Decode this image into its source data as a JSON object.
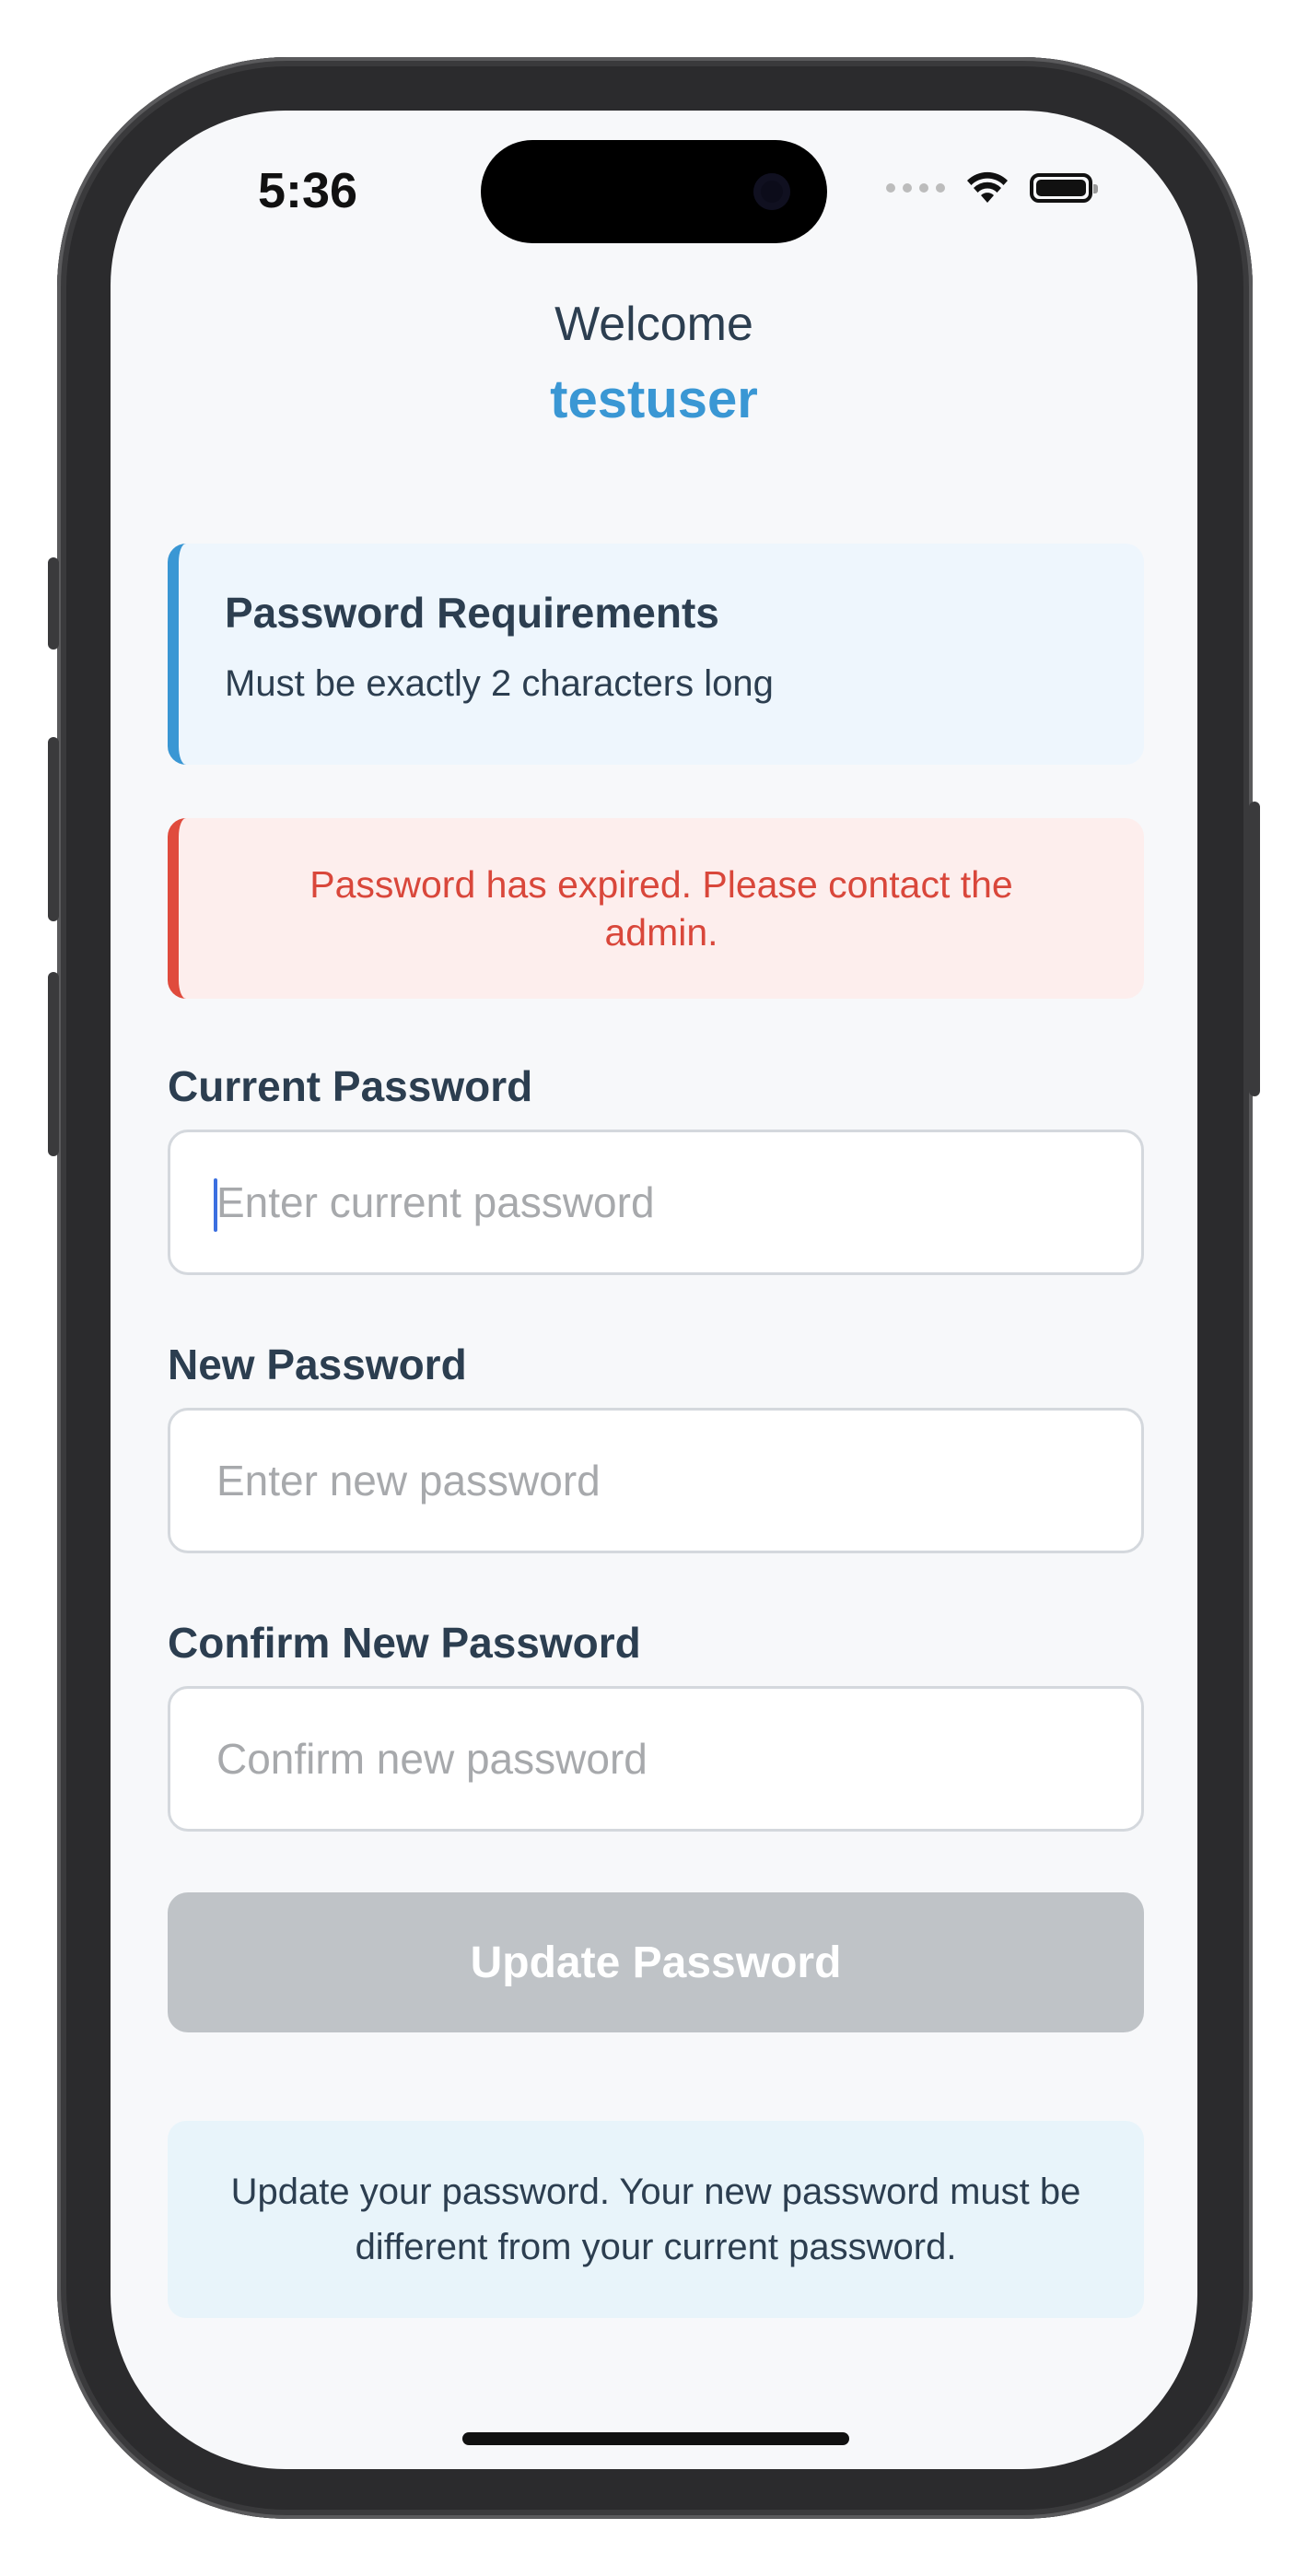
{
  "status_bar": {
    "time": "5:36"
  },
  "header": {
    "welcome_label": "Welcome",
    "username": "testuser"
  },
  "requirements": {
    "title": "Password Requirements",
    "text": "Must be exactly 2 characters long"
  },
  "error": {
    "message": "Password has expired. Please contact the admin."
  },
  "form": {
    "current": {
      "label": "Current Password",
      "placeholder": "Enter current password",
      "value": ""
    },
    "new": {
      "label": "New Password",
      "placeholder": "Enter new password",
      "value": ""
    },
    "confirm": {
      "label": "Confirm New Password",
      "placeholder": "Confirm new password",
      "value": ""
    },
    "submit_label": "Update Password"
  },
  "info": {
    "text": "Update your password. Your new password must be different from your current password."
  },
  "colors": {
    "accent": "#3a97d4",
    "error": "#d9473b",
    "text": "#2c3e50",
    "button_disabled": "#bfc3c7"
  }
}
